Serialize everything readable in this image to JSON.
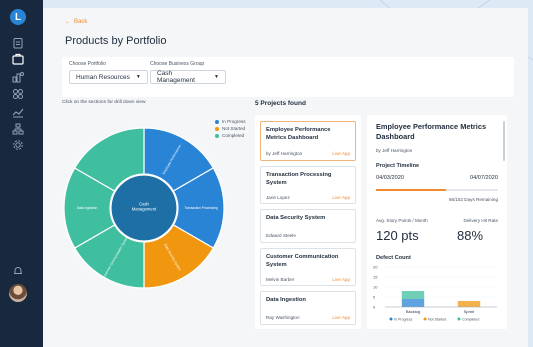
{
  "app": {
    "logo_letter": "L"
  },
  "sidebar": {
    "icons": [
      "clipboard-icon",
      "portfolio-icon",
      "analytics-icon",
      "grid-icon",
      "trend-icon",
      "org-chart-icon",
      "settings-icon",
      "notification-icon"
    ]
  },
  "header": {
    "back_label": "Back",
    "title": "Products by Portfolio"
  },
  "filters": {
    "portfolio_label": "Choose Portfolio",
    "portfolio_value": "Human Resources",
    "group_label": "Choose Business Group",
    "group_value": "Cash Management"
  },
  "chart_hint": "Click on the sections for drill down view",
  "colors": {
    "accent": "#f28a2e",
    "in_progress": "#2a84d6",
    "not_started": "#f0960f",
    "completed": "#3fbf9f",
    "center": "#1d6fa5",
    "sidebar": "#17283f"
  },
  "chart_data": {
    "type": "sunburst",
    "center_label": "Cash Management",
    "legend": [
      "In Progress",
      "Not Started",
      "Completed"
    ],
    "segments": [
      {
        "label": "Employee Performance...",
        "status": "In Progress"
      },
      {
        "label": "Transaction Processing",
        "status": "In Progress"
      },
      {
        "label": "Data Security System",
        "status": "Not Started"
      },
      {
        "label": "Customer Communication System",
        "status": "Completed"
      },
      {
        "label": "Data Ingestion",
        "status": "Completed"
      },
      {
        "label": "",
        "status": "Completed"
      }
    ]
  },
  "projects": {
    "count_label": "5 Projects found",
    "link_label": "Live App",
    "items": [
      {
        "title": "Employee Performance Metrics Dashboard",
        "author": "by Jeff Harrington"
      },
      {
        "title": "Transaction Processing System",
        "author": "Jane Lopez"
      },
      {
        "title": "Data Security System",
        "author": "Edward Steele"
      },
      {
        "title": "Customer Communication System",
        "author": "Melvin Barber"
      },
      {
        "title": "Data Ingestion",
        "author": "Ray Washington"
      }
    ]
  },
  "detail": {
    "title": "Employee Performance Metrics Dashboard",
    "author": "by Jeff Harrington",
    "timeline_label": "Project Timeline",
    "start_date": "04/03/2020",
    "end_date": "04/07/2020",
    "days_remaining": "66/152 Days Remaining",
    "progress_fraction": 0.57,
    "story_points_label": "Avg. Story Points / Month",
    "story_points_value": "120 pts",
    "hit_rate_label": "Delivery Hit Rate",
    "hit_rate_value": "88%",
    "defect_label": "Defect Count",
    "defect_chart": {
      "type": "bar",
      "categories": [
        "Backlog",
        "Sprint"
      ],
      "yticks": [
        "20",
        "15",
        "10",
        "5",
        "0"
      ],
      "ylim": [
        0,
        20
      ],
      "legend": [
        "In Progress",
        "Not Started",
        "Completed"
      ],
      "series": [
        {
          "name": "In Progress",
          "values": [
            4,
            0
          ]
        },
        {
          "name": "Not Started",
          "values": [
            0,
            3
          ]
        },
        {
          "name": "Completed",
          "values": [
            4,
            0
          ]
        }
      ]
    }
  }
}
